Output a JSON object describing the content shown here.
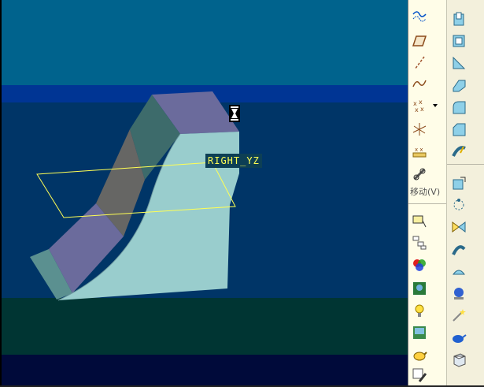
{
  "viewport": {
    "datum_plane_label": "RIGHT_YZ",
    "colors": {
      "background_top": "#00638d",
      "background_blue_stripe": "#003594",
      "background_mid": "#003567",
      "background_ground": "#003533",
      "background_bottom": "#000a3a",
      "surface_light": "#99cdcd",
      "surface_dark": "#666664",
      "surface_violet": "#6b6b9c",
      "datum_plane": "#ffff54"
    }
  },
  "toolbar": {
    "move_label": "移动(V)",
    "icons_left": [
      "datum-curve-sketch-icon",
      "datum-plane-icon",
      "datum-axis-icon",
      "datum-curve-icon",
      "datum-point-icon",
      "coordinate-system-icon",
      "analysis-feature-icon",
      "copy-move-icon",
      "note-icon",
      "layer-tree-icon",
      "color-appearance-icon",
      "scene-icon",
      "light-icon",
      "image-icon",
      "teapot-icon",
      "paint-icon"
    ],
    "icons_right": [
      "extrude-icon",
      "shell-icon",
      "rib-icon",
      "protrusion-icon",
      "round-icon",
      "chamfer-icon",
      "sweep-icon",
      "warp-icon",
      "pattern-icon",
      "mirror-icon",
      "trim-icon",
      "surface-icon",
      "surface-patch-icon",
      "sphere-render-icon",
      "magic-wand-icon",
      "teapot-render-icon",
      "cube-render-icon"
    ]
  }
}
